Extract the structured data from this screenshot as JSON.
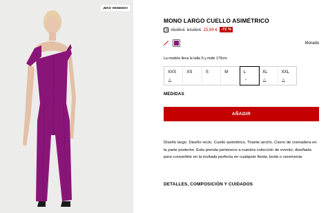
{
  "photo": {
    "badge": "¡MÁS VENDIDO!",
    "image_icon": "model-photo",
    "garment_color": "#8a1578"
  },
  "product": {
    "title": "MONO LARGO CUELLO ASIMÉTRICO",
    "price": {
      "info_icon": "info-square-icon",
      "old_price_1": "49,99 €",
      "old_price_2": "54,99 €",
      "new_price": "15,99 €",
      "discount": "-72 %"
    },
    "colors": [
      {
        "name": "slashed-swatch",
        "hex": "#c8102e"
      },
      {
        "name": "Morado",
        "hex": "#8a1578",
        "selected": true
      }
    ],
    "selected_color_name": "Morado",
    "model_note": "La modelo lleva la talla S y mide 179cm.",
    "sizes": [
      {
        "label": "XXS",
        "status": "bell"
      },
      {
        "label": "XS",
        "status": ""
      },
      {
        "label": "S",
        "status": ""
      },
      {
        "label": "M",
        "status": ""
      },
      {
        "label": "L",
        "status": "dash",
        "selected": true
      },
      {
        "label": "XL",
        "status": "bell"
      },
      {
        "label": "XXL",
        "status": "bell"
      }
    ],
    "medidas_label": "MEDIDAS",
    "add_button": "AÑADIR",
    "description": "Diseño largo. Diseño recto. Cuello asimétrico. Tirante ancho. Cierre de cremallera en la parte posterior. Esta prenda pertenece a nuestra colección de evento, diseñada para convertirte en la invitada perfecta en cualquier fiesta, boda o ceremonia",
    "details_label": "DETALLES, COMPOSICIÓN Y CUIDADOS",
    "accent_color": "#c40000"
  }
}
